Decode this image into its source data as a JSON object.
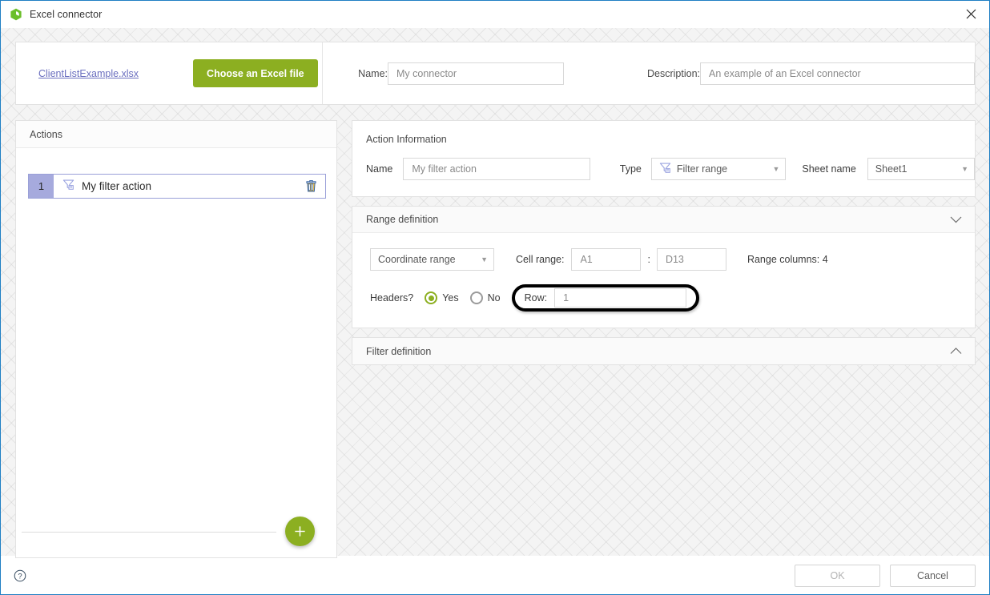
{
  "window": {
    "title": "Excel connector",
    "app_icon": "excel-connector-icon",
    "close_icon": "close-icon",
    "accent_green": "#8caf21",
    "accent_blue_border": "#1f7fc4",
    "action_badge_color": "#a6aadd"
  },
  "header": {
    "file_link": "ClientListExample.xlsx",
    "choose_button": "Choose an Excel file",
    "name_label": "Name:",
    "name_value": "My connector",
    "description_label": "Description:",
    "description_value": "An example of an Excel connector"
  },
  "actions_panel": {
    "title": "Actions",
    "rows": [
      {
        "number": "1",
        "icon": "filter-range-icon",
        "label": "My filter action",
        "delete_icon": "trash-icon"
      }
    ],
    "add_button_icon": "plus-icon"
  },
  "action_information": {
    "title": "Action Information",
    "name_label": "Name",
    "name_value": "My filter action",
    "type_label": "Type",
    "type_value": "Filter range",
    "type_icon": "filter-range-icon",
    "sheet_label": "Sheet name",
    "sheet_value": "Sheet1"
  },
  "range_definition": {
    "title": "Range definition",
    "chevron": "chevron-down-icon",
    "mode_value": "Coordinate range",
    "cell_range_label": "Cell range:",
    "cell_from": "A1",
    "separator": ":",
    "cell_to": "D13",
    "range_columns": "Range columns: 4",
    "headers_label": "Headers?",
    "yes_label": "Yes",
    "no_label": "No",
    "headers_selected": "Yes",
    "row_label": "Row:",
    "row_value": "1"
  },
  "filter_definition": {
    "title": "Filter definition",
    "chevron": "chevron-up-icon"
  },
  "footer": {
    "help_icon": "help-icon",
    "ok_label": "OK",
    "cancel_label": "Cancel"
  }
}
